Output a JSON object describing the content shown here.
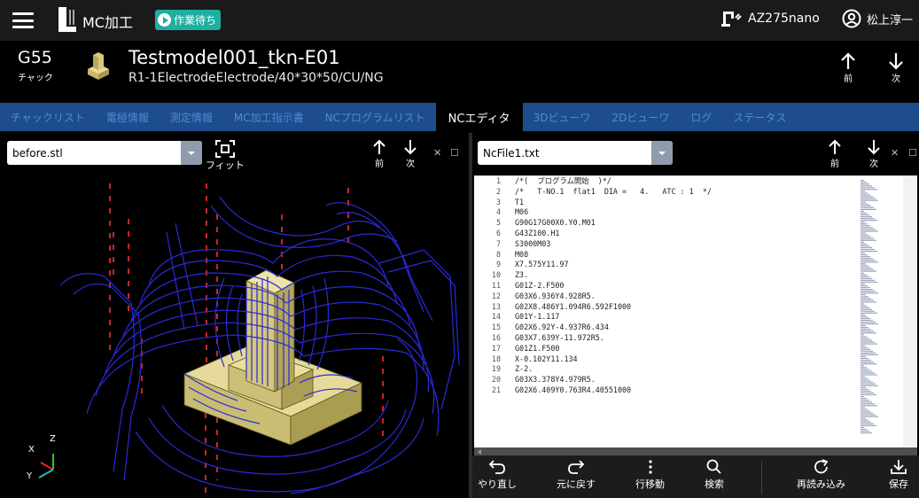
{
  "app": {
    "title": "MC加工",
    "status": "作業待ち"
  },
  "machine": {
    "name": "AZ275nano"
  },
  "user": {
    "name": "松上淳一"
  },
  "job": {
    "coordinate": "G55",
    "holder": "チャック",
    "model_name": "Testmodel001_tkn-E01",
    "model_spec": "R1-1ElectrodeElectrode/40*30*50/CU/NG"
  },
  "nav": {
    "prev": "前",
    "next": "次"
  },
  "tabs": [
    {
      "label": "チャックリスト",
      "active": false
    },
    {
      "label": "電極情報",
      "active": false
    },
    {
      "label": "測定情報",
      "active": false
    },
    {
      "label": "MC加工指示書",
      "active": false
    },
    {
      "label": "NCプログラムリスト",
      "active": false
    },
    {
      "label": "NCエディタ",
      "active": true
    },
    {
      "label": "3Dビューワ",
      "active": false
    },
    {
      "label": "2Dビューワ",
      "active": false
    },
    {
      "label": "ログ",
      "active": false
    },
    {
      "label": "ステータス",
      "active": false
    }
  ],
  "left_pane": {
    "file_select": "before.stl",
    "fit_label": "フィット",
    "prev": "前",
    "next": "次",
    "axes": {
      "x": "X",
      "y": "Y",
      "z": "Z"
    }
  },
  "right_pane": {
    "file_select": "NcFile1.txt",
    "prev": "前",
    "next": "次"
  },
  "editor": {
    "lines": [
      "/*(  プログラム開始  )*/",
      "/*   T-NO.1  flat1  DIA =   4.   ATC : 1  */",
      "T1",
      "M06",
      "G90G17G00X0.Y0.M01",
      "G43Z100.H1",
      "S3000M03",
      "M08",
      "X7.575Y11.97",
      "Z3.",
      "G01Z-2.F500",
      "G03X6.936Y4.928R5.",
      "G02X8.486Y1.094R6.592F1000",
      "G01Y-1.117",
      "G02X6.92Y-4.937R6.434",
      "G03X7.639Y-11.972R5.",
      "G01Z1.F500",
      "X-0.102Y11.134",
      "Z-2.",
      "G03X3.378Y4.979R5.",
      "G02X6.409Y0.763R4.40551000"
    ]
  },
  "actions": {
    "undo": "やり直し",
    "redo": "元に戻す",
    "goto_line": "行移動",
    "search": "検索",
    "reload": "再読み込み",
    "save": "保存"
  },
  "colors": {
    "status_badge": "#1db0a0",
    "tab_bar": "#1d4d8c",
    "tab_text": "#4c8cd9",
    "wireframe": "#2a2ad8",
    "model": "#e0d494"
  }
}
